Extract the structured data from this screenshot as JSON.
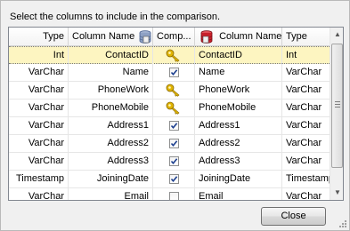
{
  "instruction": "Select the columns to include in the comparison.",
  "headers": {
    "type_left": "Type",
    "column_name_left": "Column Name",
    "compare": "Comp...",
    "column_name_right": "Column Name",
    "type_right": "Type"
  },
  "rows": [
    {
      "type_left": "Int",
      "name_left": "ContactID",
      "compare": "key",
      "name_right": "ContactID",
      "type_right": "Int",
      "selected": true
    },
    {
      "type_left": "VarChar",
      "name_left": "Name",
      "compare": "checked",
      "name_right": "Name",
      "type_right": "VarChar"
    },
    {
      "type_left": "VarChar",
      "name_left": "PhoneWork",
      "compare": "key",
      "name_right": "PhoneWork",
      "type_right": "VarChar"
    },
    {
      "type_left": "VarChar",
      "name_left": "PhoneMobile",
      "compare": "key",
      "name_right": "PhoneMobile",
      "type_right": "VarChar"
    },
    {
      "type_left": "VarChar",
      "name_left": "Address1",
      "compare": "checked",
      "name_right": "Address1",
      "type_right": "VarChar"
    },
    {
      "type_left": "VarChar",
      "name_left": "Address2",
      "compare": "checked",
      "name_right": "Address2",
      "type_right": "VarChar"
    },
    {
      "type_left": "VarChar",
      "name_left": "Address3",
      "compare": "checked",
      "name_right": "Address3",
      "type_right": "VarChar"
    },
    {
      "type_left": "Timestamp",
      "name_left": "JoiningDate",
      "compare": "checked",
      "name_right": "JoiningDate",
      "type_right": "Timestamp"
    },
    {
      "type_left": "VarChar",
      "name_left": "Email",
      "compare": "unchecked",
      "name_right": "Email",
      "type_right": "VarChar"
    }
  ],
  "buttons": {
    "close": "Close"
  },
  "icons": {
    "left_db": "database-icon-blue",
    "right_db": "database-icon-red",
    "key": "key-icon",
    "check": "checkmark-icon"
  },
  "colors": {
    "selected_row": "#fdf5c1",
    "key_gold": "#e0b400",
    "check_blue": "#1c3f8f",
    "db_red": "#c8202a",
    "db_blue": "#6d87b3"
  }
}
